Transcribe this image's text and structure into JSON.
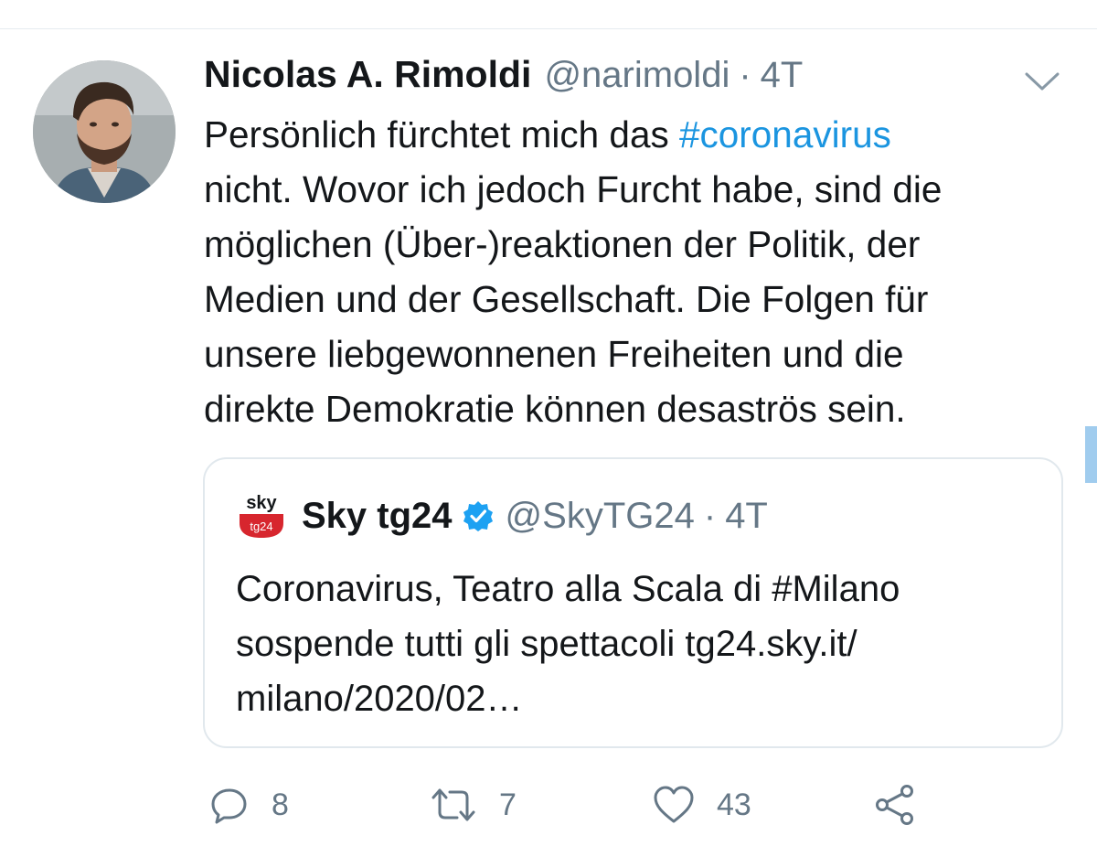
{
  "tweet": {
    "display_name": "Nicolas A. Rimoldi",
    "handle": "@narimoldi",
    "separator": "·",
    "time": "4T",
    "text_lines": [
      {
        "before": "Persönlich fürchtet mich das ",
        "hashtag": "#coronavirus"
      },
      "nicht. Wovor ich jedoch Furcht habe, sind die",
      "möglichen (Über-)reaktionen der Politik, der",
      "Medien und der Gesellschaft. Die Folgen für",
      "unsere liebgewonnenen Freiheiten und die",
      "direkte Demokratie können desaströs sein."
    ]
  },
  "quoted_tweet": {
    "logo_text_top": "sky",
    "logo_text_bottom": "tg24",
    "display_name": "Sky tg24",
    "verified": true,
    "handle": "@SkyTG24",
    "separator": "·",
    "time": "4T",
    "text_lines": [
      "Coronavirus, Teatro alla Scala di #Milano",
      "sospende tutti gli spettacoli tg24.sky.it/",
      "milano/2020/02…"
    ]
  },
  "actions": {
    "reply": {
      "icon": "reply-icon",
      "count": "8"
    },
    "retweet": {
      "icon": "retweet-icon",
      "count": "7"
    },
    "like": {
      "icon": "heart-icon",
      "count": "43"
    },
    "share": {
      "icon": "share-icon"
    }
  },
  "colors": {
    "link": "#1b95e0",
    "secondary_text": "#657786",
    "border": "#e1e8ed",
    "verified": "#1da1f2",
    "sky_red": "#d7262e"
  }
}
